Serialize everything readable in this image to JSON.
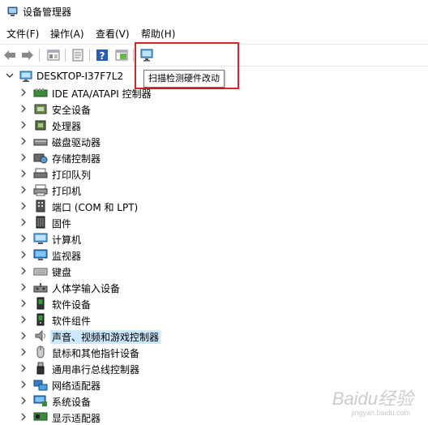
{
  "window": {
    "title": "设备管理器"
  },
  "menu": [
    {
      "label": "文件(F)"
    },
    {
      "label": "操作(A)"
    },
    {
      "label": "查看(V)"
    },
    {
      "label": "帮助(H)"
    }
  ],
  "toolbar": {
    "buttons": [
      "back-icon",
      "forward-icon",
      "properties-icon",
      "driver-update-icon",
      "help-icon",
      "view-icon",
      "scan-hardware-icon"
    ],
    "tooltip": "扫描检测硬件改动"
  },
  "tree": {
    "root": "DESKTOP-I37F7L2",
    "categories": [
      {
        "label": "IDE ATA/ATAPI 控制器",
        "icon": "ide-controller-icon"
      },
      {
        "label": "安全设备",
        "icon": "security-device-icon"
      },
      {
        "label": "处理器",
        "icon": "processor-icon"
      },
      {
        "label": "磁盘驱动器",
        "icon": "disk-drive-icon"
      },
      {
        "label": "存储控制器",
        "icon": "storage-controller-icon"
      },
      {
        "label": "打印队列",
        "icon": "print-queue-icon"
      },
      {
        "label": "打印机",
        "icon": "printer-icon"
      },
      {
        "label": "端口 (COM 和 LPT)",
        "icon": "port-icon"
      },
      {
        "label": "固件",
        "icon": "firmware-icon"
      },
      {
        "label": "计算机",
        "icon": "computer-icon"
      },
      {
        "label": "监视器",
        "icon": "monitor-icon"
      },
      {
        "label": "键盘",
        "icon": "keyboard-icon"
      },
      {
        "label": "人体学输入设备",
        "icon": "hid-icon"
      },
      {
        "label": "软件设备",
        "icon": "software-device-icon"
      },
      {
        "label": "软件组件",
        "icon": "software-component-icon"
      },
      {
        "label": "声音、视频和游戏控制器",
        "icon": "audio-icon",
        "selected": true
      },
      {
        "label": "鼠标和其他指针设备",
        "icon": "mouse-icon"
      },
      {
        "label": "通用串行总线控制器",
        "icon": "usb-icon"
      },
      {
        "label": "网络适配器",
        "icon": "network-adapter-icon"
      },
      {
        "label": "系统设备",
        "icon": "system-device-icon"
      },
      {
        "label": "显示适配器",
        "icon": "display-adapter-icon"
      }
    ]
  },
  "colors": {
    "highlight_box": "#e0202a",
    "selection": "#cce8ff"
  },
  "watermark": {
    "brand": "Baidu经验",
    "url": "jingyan.baidu.com"
  }
}
